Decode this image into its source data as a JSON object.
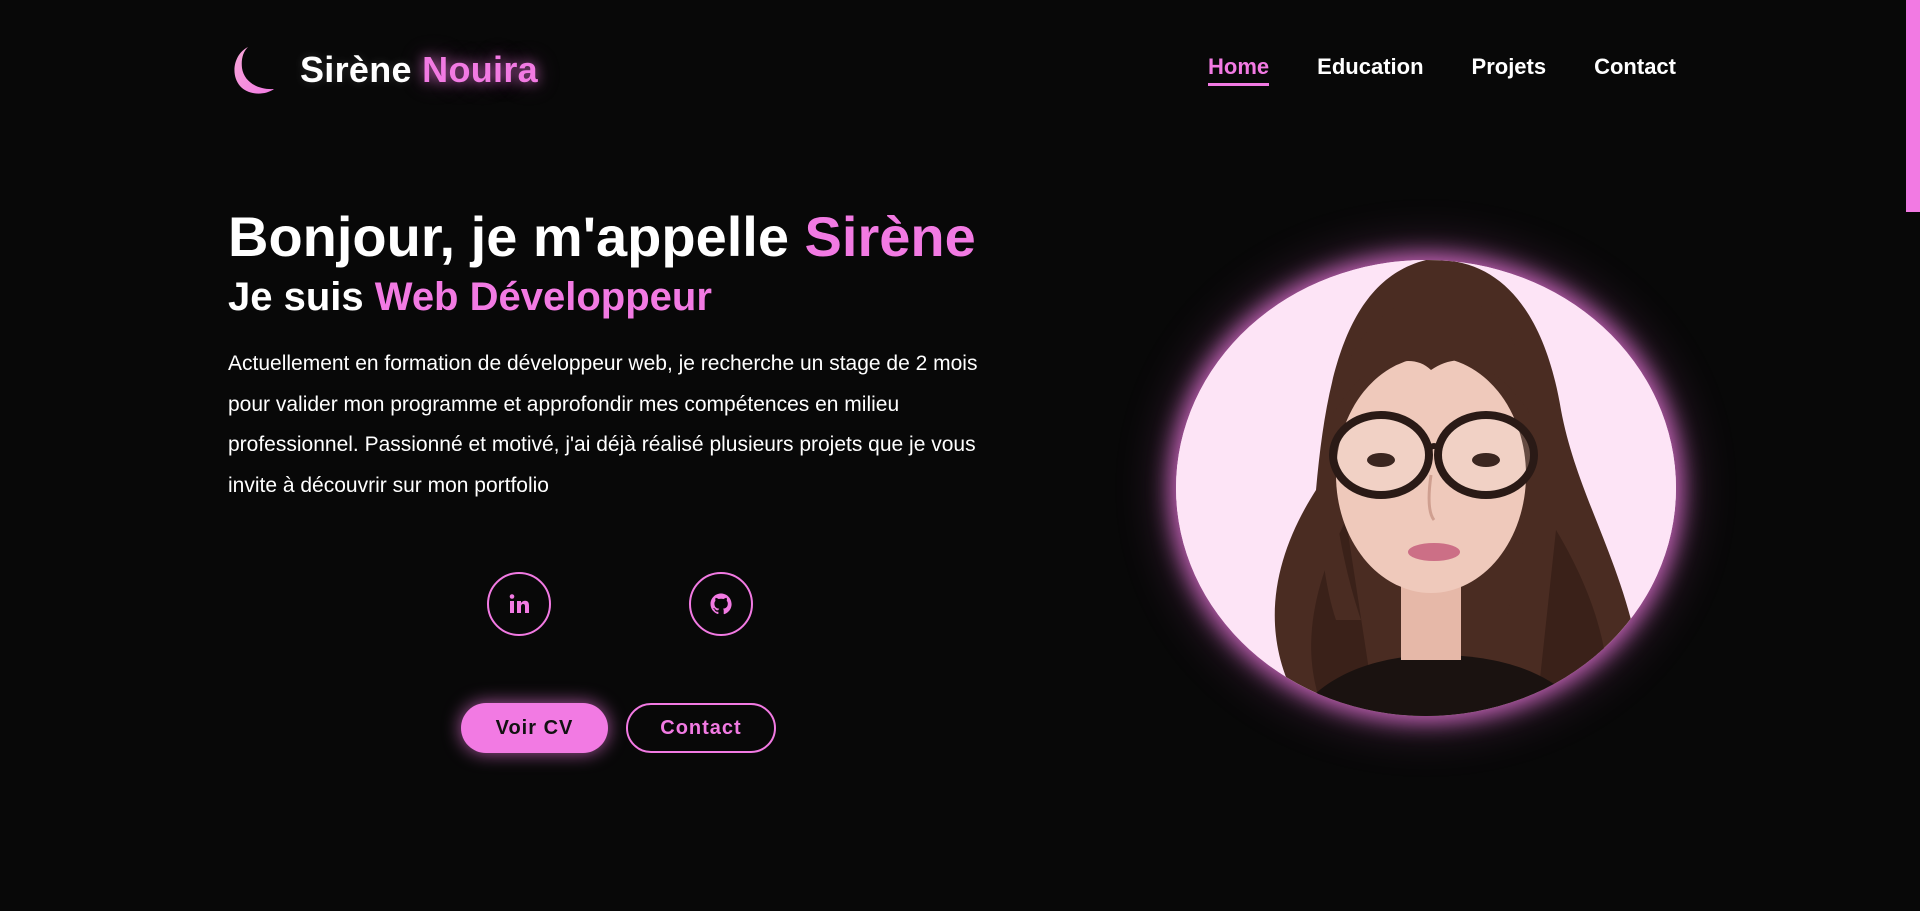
{
  "brand": {
    "first": "Sirène",
    "last": "Nouira",
    "logo_icon": "moon-icon"
  },
  "nav": {
    "items": [
      {
        "label": "Home",
        "active": true
      },
      {
        "label": "Education",
        "active": false
      },
      {
        "label": "Projets",
        "active": false
      },
      {
        "label": "Contact",
        "active": false
      }
    ]
  },
  "hero": {
    "greeting": "Bonjour, je m'appelle",
    "name": "Sirène",
    "role_prefix": "Je suis",
    "role": "Web Développeur",
    "description": "Actuellement en formation de développeur web, je recherche un stage de 2 mois pour valider mon programme et approfondir mes compétences en milieu professionnel. Passionné et motivé, j'ai déjà réalisé plusieurs projets que je vous invite à découvrir sur mon portfolio"
  },
  "socials": [
    {
      "icon": "linkedin-icon",
      "label": "in"
    },
    {
      "icon": "github-icon"
    }
  ],
  "buttons": {
    "cv": "Voir CV",
    "contact": "Contact"
  },
  "colors": {
    "accent": "#f27ae3",
    "background": "#080808",
    "portrait_bg": "#fde4f6"
  }
}
